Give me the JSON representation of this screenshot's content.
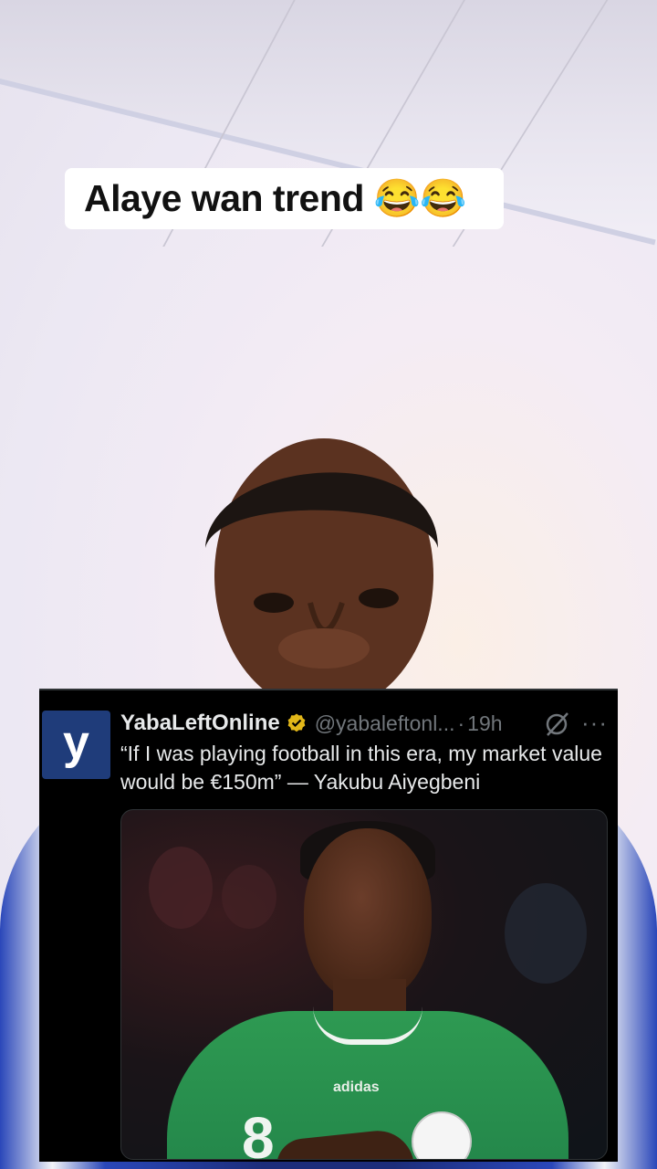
{
  "caption": {
    "text": "Alaye wan trend 😂😂"
  },
  "tweet": {
    "avatar_letter": "y",
    "display_name": "YabaLeftOnline",
    "handle": "@yabaleftonl...",
    "separator": "·",
    "time": "19h",
    "more": "···",
    "text": "“If I was playing football in this era, my market value would be €150m” —  Yakubu Aiyegbeni",
    "media": {
      "jersey_brand": "adidas",
      "jersey_number": "8"
    }
  },
  "colors": {
    "caption_bg": "#ffffff",
    "tweet_bg": "#000000",
    "verified_badge": "#e2b719",
    "avatar_bg": "#1f3c7a"
  },
  "icons": [
    "verified-badge-icon",
    "grok-icon",
    "more-icon"
  ]
}
